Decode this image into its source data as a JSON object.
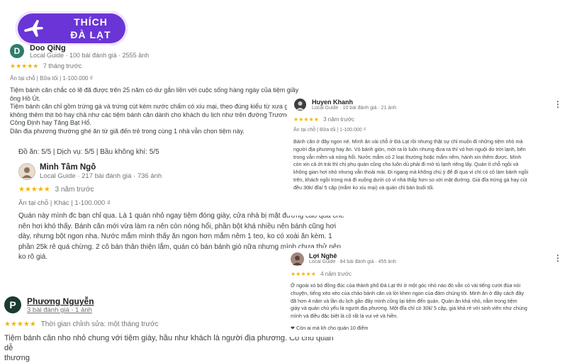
{
  "brand": {
    "line1": "THÍCH",
    "line2": "ĐÀ LẠT"
  },
  "colors": {
    "star": "#f4b400",
    "brand": "#6a35d6"
  },
  "reviews": {
    "r1": {
      "avatar_letter": "D",
      "name": "Doo QiNg",
      "meta": "Local Guide · 100 bài đánh giá · 2555 ảnh",
      "stars": "★★★★★",
      "time": "7 tháng trước",
      "tags": "Ăn tại chỗ  |  Bữa tối  |  1-100.000 ₫",
      "lines": [
        "Tiệm bánh căn chắc có lẽ đã được trên 25 năm có dư gắn liền với cuộc sống hàng ngày của tiệm giầy",
        "ông Hồ Út.",
        "Tiệm bánh căn chỉ gồm trứng gà và trứng cút kèm nước chấm có xíu mại, theo đúng kiểu từ xưa giờ",
        "không thêm thịt bò hay chả như các tiệm bánh căn dành cho khách du lịch như trên đường Trương",
        "Công Định hay Tăng Bạt Hổ.",
        "Dân địa phương thường ghé ăn từ giã đến trẻ trong cùng 1 nhà vẫn chọn tiệm này."
      ]
    },
    "r2": {
      "ratings": "Đồ ăn: 5/5  |  Dịch vụ: 5/5  |  Bầu không khí: 5/5",
      "name": "Minh Tâm Ngô",
      "meta": "Local Guide · 217 bài đánh giá · 736 ảnh",
      "stars": "★★★★★",
      "time": "3 năm trước",
      "tags": "Ăn tại chỗ  |  Khác  |  1-100.000 ₫",
      "lines": [
        "Quán này mình đc bạn chỉ qua. Là 1 quán nhỏ ngay tiệm đóng giày, cửa nhà bị mặt đường cao quá che",
        "nên hơi khó thấy. Bánh căn mới vừa làm ra nên còn nóng hổi, phần bột khá nhiều nên bánh cũng hơi",
        "dày, nhưng bột ngon nha. Nước mắm mình thấy ăn ngon hơn mắm nêm 1 teo, ko có xoài ăn kèm. 1",
        "phần 25k rẻ quá chừng. 2 cô bán thân thiện lắm, quán có bán bánh giò nữa nhưng mình chưa thử nên",
        "ko rõ giá."
      ]
    },
    "r3": {
      "avatar_letter": "P",
      "name": "Phương Nguyễn",
      "meta": "3 bài đánh giá · 1 ảnh",
      "stars": "★★★★★",
      "time": "Thời gian chỉnh sửa: một tháng trước",
      "lines": [
        "Tiệm bánh căn nho nhỏ chung với tiệm giày, hầu như khách là người địa phương. Có chủ quán dễ",
        "thương"
      ]
    },
    "r4": {
      "name": "Huyen Khanh",
      "meta": "Local Guide · 10 bài đánh giá · 21 ảnh",
      "stars": "★★★★★",
      "time": "3 năm trước",
      "tags": "Ăn tại chỗ  |  Bữa tối  |  1-100.000 ₫",
      "lines": [
        "Bánh căn ở đây ngon nè. Mình ăn vài chỗ ở Đà Lạt rồi nhưng thật sự chỉ muốn đi những tiệm nhỏ mà",
        "người địa phương hay ăn. Vỏ bánh giòn, mới ra lò luôn nhưng đưa ra thì vỏ hơi nguội do trời lạnh, bên",
        "trong vẫn mềm và nóng hổi. Nước mắm có 2 loại thường hoặc mắm nêm, hành xin thêm được. Mình",
        "còn xin cả ớt trái thì chị phụ quán cũng cho luôn dù phải đi mở tủ lạnh riêng lấy. Quán ít chỗ ngồi và",
        "không gian hơi nhỏ nhưng vẫn thoải mái. Đi ngang mà không chú ý để đi qua vì chỉ có cô làm bánh ngồi",
        "trên, khách ngồi trong mà đi xuống dưới có vỉ nhà thấp hơn so với mặt đường. Giá đĩa trứng gà hay cút",
        "đều 30k/ đĩa/ 5 cặp (mắm ko xíu mại) và quán chỉ bán buổi tối."
      ]
    },
    "r5": {
      "name": "Lợi Nghê",
      "meta": "Local Guide · 84 bài đánh giá · 455 ảnh",
      "stars": "★★★★★",
      "time": "4 năm trước",
      "lines": [
        "Ở ngoài xó bỏ đồng đúc của thành phố Đà Lạt thì ở một góc nhỏ nào đó vẫn có vài tiếng cười đùa nói",
        "chuyện, tiếng xèo xèo của chảo bánh căn và lời khen ngon của đám chúng tôi. Minh ăn ở đây cách đây",
        "đã hơn 4 năm và lần du lịch gần đây mình cũng lại tiệm đến quán. Quán ăn khá nhỏ, nằm trong tiệm",
        "giày và quán chủ yếu là người địa phương. Một đĩa chỉ có 30k/ 5 cặp, giá khá rẻ với sinh viên như chúng",
        "mình và điều đặc biệt là cô rất là vui vẻ và hiền."
      ],
      "likes": "❤ Còn ai mà kh cho quán 10 điểm"
    }
  }
}
